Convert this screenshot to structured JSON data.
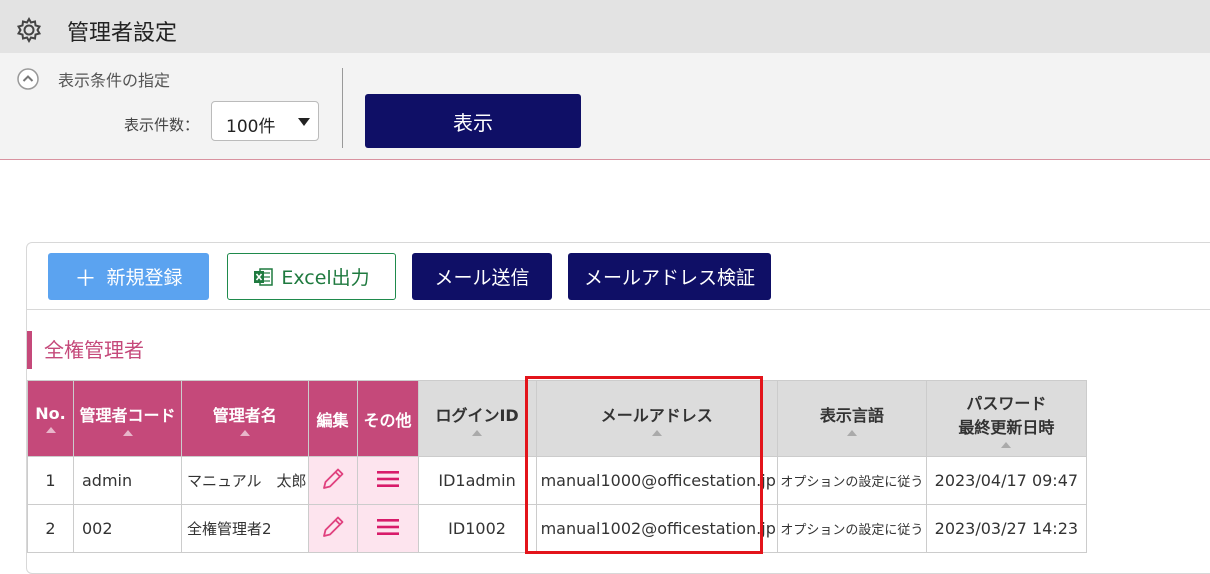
{
  "header": {
    "title": "管理者設定",
    "icon": "gear-icon"
  },
  "conditions": {
    "title": "表示条件の指定",
    "count_label": "表示件数：",
    "count_value": "100件",
    "show_button": "表示"
  },
  "toolbar": {
    "new_label": "新規登録",
    "excel_label": "Excel出力",
    "mail_send_label": "メール送信",
    "mail_verify_label": "メールアドレス検証"
  },
  "section": {
    "title": "全権管理者"
  },
  "table": {
    "headers": {
      "no": "No.",
      "code": "管理者コード",
      "name": "管理者名",
      "edit": "編集",
      "other": "その他",
      "login": "ログインID",
      "email": "メールアドレス",
      "lang": "表示言語",
      "pw_line1": "パスワード",
      "pw_line2": "最終更新日時"
    },
    "rows": [
      {
        "no": "1",
        "code": "admin",
        "name": "マニュアル　太郎",
        "login": "ID1admin",
        "email": "manual1000@officestation.jp",
        "lang": "オプションの設定に従う",
        "updated": "2023/04/17 09:47"
      },
      {
        "no": "2",
        "code": "002",
        "name": "全権管理者2",
        "login": "ID1002",
        "email": "manual1002@officestation.jp",
        "lang": "オプションの設定に従う",
        "updated": "2023/03/27 14:23"
      }
    ]
  },
  "colors": {
    "accent_pink": "#c5497a",
    "navy": "#0f0f66",
    "blue": "#5ba3f0",
    "highlight_red": "#e3141b"
  }
}
